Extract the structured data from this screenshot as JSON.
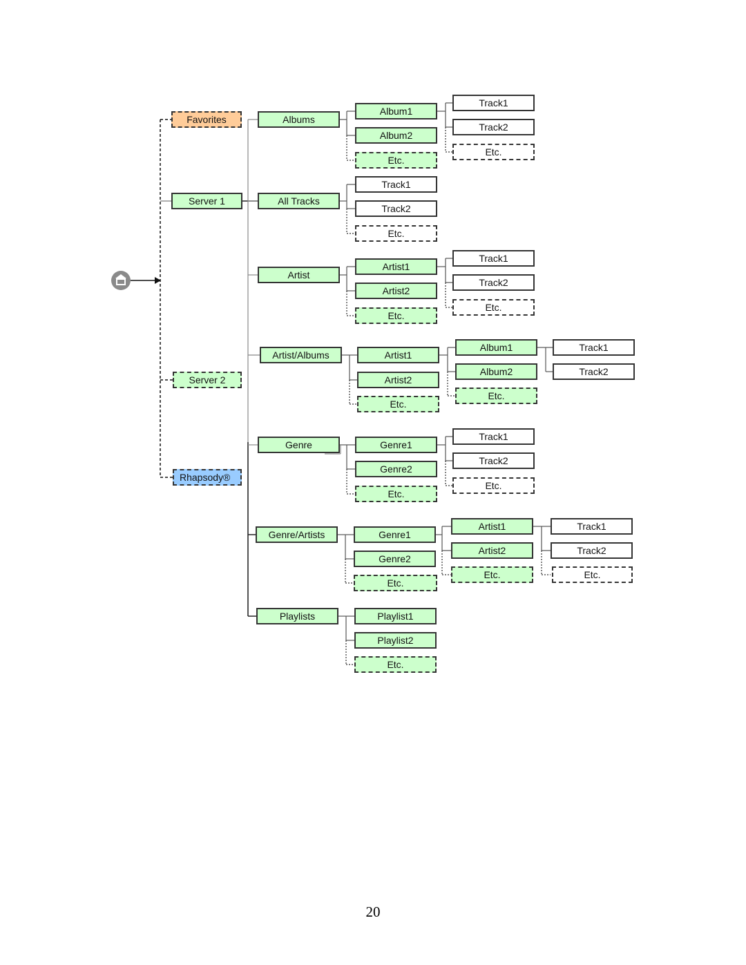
{
  "diagram": {
    "root_icon": "home-icon",
    "sources": [
      {
        "label": "Favorites",
        "style": "dashed",
        "color": "#ffcc99"
      },
      {
        "label": "Server 1",
        "style": "solid",
        "color": "#ccffcc"
      },
      {
        "label": "Server 2",
        "style": "dashed",
        "color": "#ccffcc"
      },
      {
        "label": "Rhapsody®",
        "style": "dashed",
        "color": "#99ccff"
      }
    ],
    "categories": {
      "albums": {
        "label": "Albums",
        "children": [
          "Album1",
          "Album2",
          "Etc."
        ],
        "grandchildren": [
          "Track1",
          "Track2",
          "Etc."
        ]
      },
      "all_tracks": {
        "label": "All Tracks",
        "children": [
          "Track1",
          "Track2",
          "Etc."
        ]
      },
      "artist": {
        "label": "Artist",
        "children": [
          "Artist1",
          "Artist2",
          "Etc."
        ],
        "grandchildren": [
          "Track1",
          "Track2",
          "Etc."
        ]
      },
      "artist_albums": {
        "label": "Artist/Albums",
        "children": [
          "Artist1",
          "Artist2",
          "Etc."
        ],
        "grandchildren": [
          "Album1",
          "Album2",
          "Etc."
        ],
        "great_grandchildren": [
          "Track1",
          "Track2"
        ]
      },
      "genre": {
        "label": "Genre",
        "children": [
          "Genre1",
          "Genre2",
          "Etc."
        ],
        "grandchildren": [
          "Track1",
          "Track2",
          "Etc."
        ]
      },
      "genre_artists": {
        "label": "Genre/Artists",
        "children": [
          "Genre1",
          "Genre2",
          "Etc."
        ],
        "grandchildren": [
          "Artist1",
          "Artist2",
          "Etc."
        ],
        "great_grandchildren": [
          "Track1",
          "Track2",
          "Etc."
        ]
      },
      "playlists": {
        "label": "Playlists",
        "children": [
          "Playlist1",
          "Playlist2",
          "Etc."
        ]
      }
    },
    "colors": {
      "folder_fill": "#ccffcc",
      "track_fill": "#ffffff",
      "favorites_fill": "#ffcc99",
      "rhapsody_fill": "#99ccff",
      "border": "#333333"
    }
  },
  "page_number": "20"
}
